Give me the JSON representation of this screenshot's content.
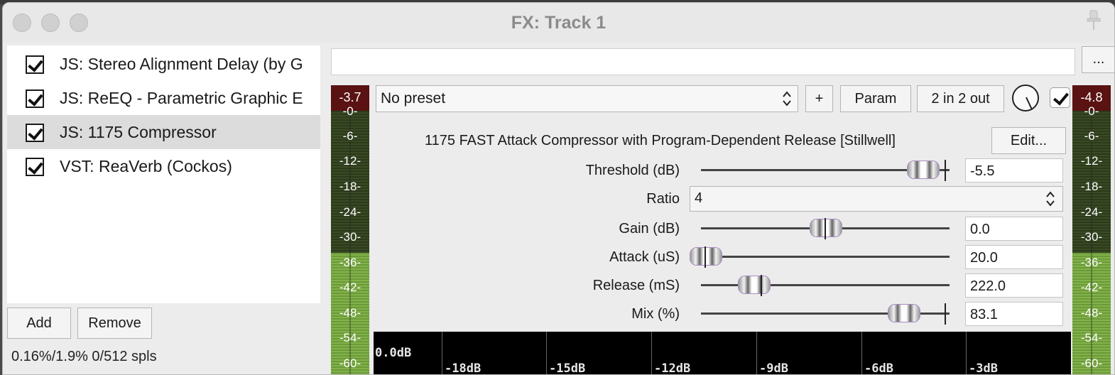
{
  "window": {
    "title": "FX: Track 1",
    "pin_icon": "pin-icon"
  },
  "fx_chain": {
    "items": [
      {
        "label": "JS: Stereo Alignment Delay (by G",
        "checked": true,
        "selected": false
      },
      {
        "label": "JS: ReEQ - Parametric Graphic E",
        "checked": true,
        "selected": false
      },
      {
        "label": "JS: 1175 Compressor",
        "checked": true,
        "selected": true
      },
      {
        "label": "VST: ReaVerb (Cockos)",
        "checked": true,
        "selected": false
      }
    ],
    "add_label": "Add",
    "remove_label": "Remove",
    "status": "0.16%/1.9% 0/512 spls"
  },
  "top_bar": {
    "search_value": "",
    "more_label": "..."
  },
  "input_meter": {
    "peak": "-3.7",
    "ticks": [
      "-0-",
      "-6-",
      "-12-",
      "-18-",
      "-24-",
      "-30-",
      "-36-",
      "-42-",
      "-48-",
      "-54-",
      "-60-"
    ]
  },
  "output_meter": {
    "peak": "-4.8",
    "ticks": [
      "-0-",
      "-6-",
      "-12-",
      "-18-",
      "-24-",
      "-30-",
      "-36-",
      "-42-",
      "-48-",
      "-54-",
      "-60-"
    ]
  },
  "plugin_toolbar": {
    "preset": "No preset",
    "plus_label": "+",
    "param_label": "Param",
    "io_label": "2 in 2 out",
    "enabled": true
  },
  "plugin": {
    "title": "1175 FAST Attack Compressor with Program-Dependent Release [Stillwell]",
    "edit_label": "Edit...",
    "params": {
      "threshold": {
        "label": "Threshold (dB)",
        "value": "-5.5",
        "position": 0.89
      },
      "ratio": {
        "label": "Ratio",
        "value": "4"
      },
      "gain": {
        "label": "Gain (dB)",
        "value": "0.0",
        "position": 0.5
      },
      "attack": {
        "label": "Attack (uS)",
        "value": "20.0",
        "position": 0.0
      },
      "release": {
        "label": "Release (mS)",
        "value": "222.0",
        "position": 0.2
      },
      "mix": {
        "label": "Mix (%)",
        "value": "83.1",
        "position": 0.83
      }
    },
    "gr_meter": {
      "labels": [
        "0.0dB",
        "-18dB",
        "-15dB",
        "-12dB",
        "-9dB",
        "-6dB",
        "-3dB"
      ]
    }
  }
}
